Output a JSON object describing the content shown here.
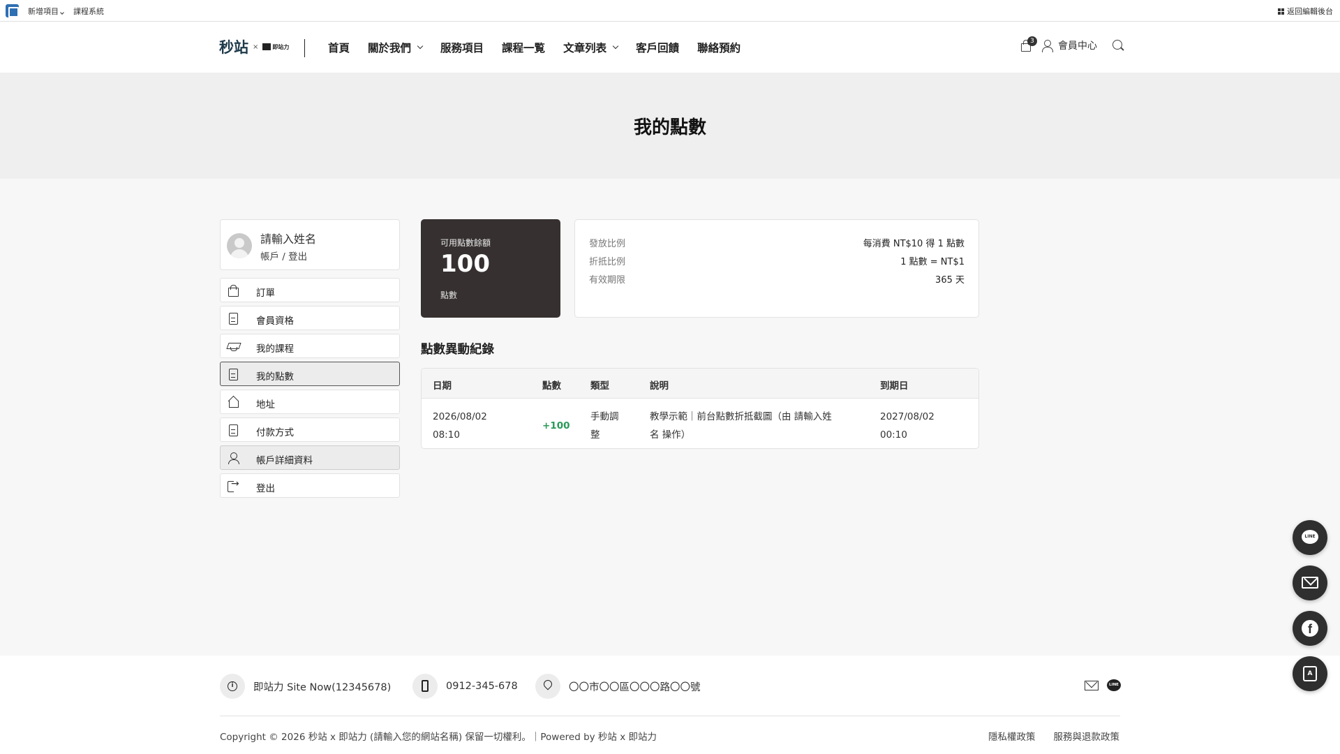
{
  "admin_bar": {
    "new_item": "新增項目",
    "course_system": "課程系統",
    "back_to_admin": "返回編輯後台"
  },
  "header": {
    "logo_main": "秒站",
    "logo_x": "×",
    "logo_partner": "即站力",
    "nav": [
      "首頁",
      "關於我們",
      "服務項目",
      "課程一覧",
      "文章列表",
      "客戶回饋",
      "聯絡預約"
    ],
    "cart_count": "3",
    "member_center": "會員中心"
  },
  "hero": {
    "title": "我的點數"
  },
  "sidebar": {
    "name": "請輸入姓名",
    "account_link": "帳戶",
    "separator": "/",
    "logout_link": "登出",
    "items": [
      {
        "label": "訂單",
        "icon": "shopping-bag-icon"
      },
      {
        "label": "會員資格",
        "icon": "document-icon"
      },
      {
        "label": "我的課程",
        "icon": "graduation-cap-icon"
      },
      {
        "label": "我的點數",
        "icon": "document-icon"
      },
      {
        "label": "地址",
        "icon": "home-icon"
      },
      {
        "label": "付款方式",
        "icon": "document-icon"
      },
      {
        "label": "帳戶詳細資料",
        "icon": "user-icon"
      },
      {
        "label": "登出",
        "icon": "logout-icon"
      }
    ]
  },
  "balance": {
    "label": "可用點數餘額",
    "value": "100",
    "unit": "點數"
  },
  "rules": [
    {
      "key": "發放比例",
      "value": "每消費 NT$10 得 1 點數"
    },
    {
      "key": "折抵比例",
      "value": "1 點數 = NT$1"
    },
    {
      "key": "有效期限",
      "value": "365 天"
    }
  ],
  "history": {
    "title": "點數異動紀錄",
    "headers": [
      "日期",
      "點數",
      "類型",
      "說明",
      "到期日"
    ],
    "rows": [
      {
        "date_line1": "2026/08/02",
        "date_line2": "08:10",
        "points": "+100",
        "type_line1": "手動調",
        "type_line2": "整",
        "desc_line1": "教學示範｜前台點數折抵截圖（由 請輸入姓",
        "desc_line2": "名 操作）",
        "expiry_line1": "2027/08/02",
        "expiry_line2": "00:10"
      }
    ]
  },
  "footer": {
    "company": "即站力 Site Now(12345678)",
    "phone": "0912-345-678",
    "address": "〇〇市〇〇區〇〇〇路〇〇號",
    "copyright": "Copyright © 2026 秒站 x 即站力 (請輸入您的網站名稱) 保留一切權利。｜Powered by 秒站 x 即站力",
    "privacy": "隱私權政策",
    "refund": "服務與退款政策",
    "line_text": "LINE"
  },
  "floating": {
    "line_text": "LINE",
    "facebook_text": "f",
    "form_text": "A"
  },
  "colors": {
    "balance_card": "#363130",
    "points_positive": "#2a9a57",
    "float_button": "#2f2f2f"
  }
}
